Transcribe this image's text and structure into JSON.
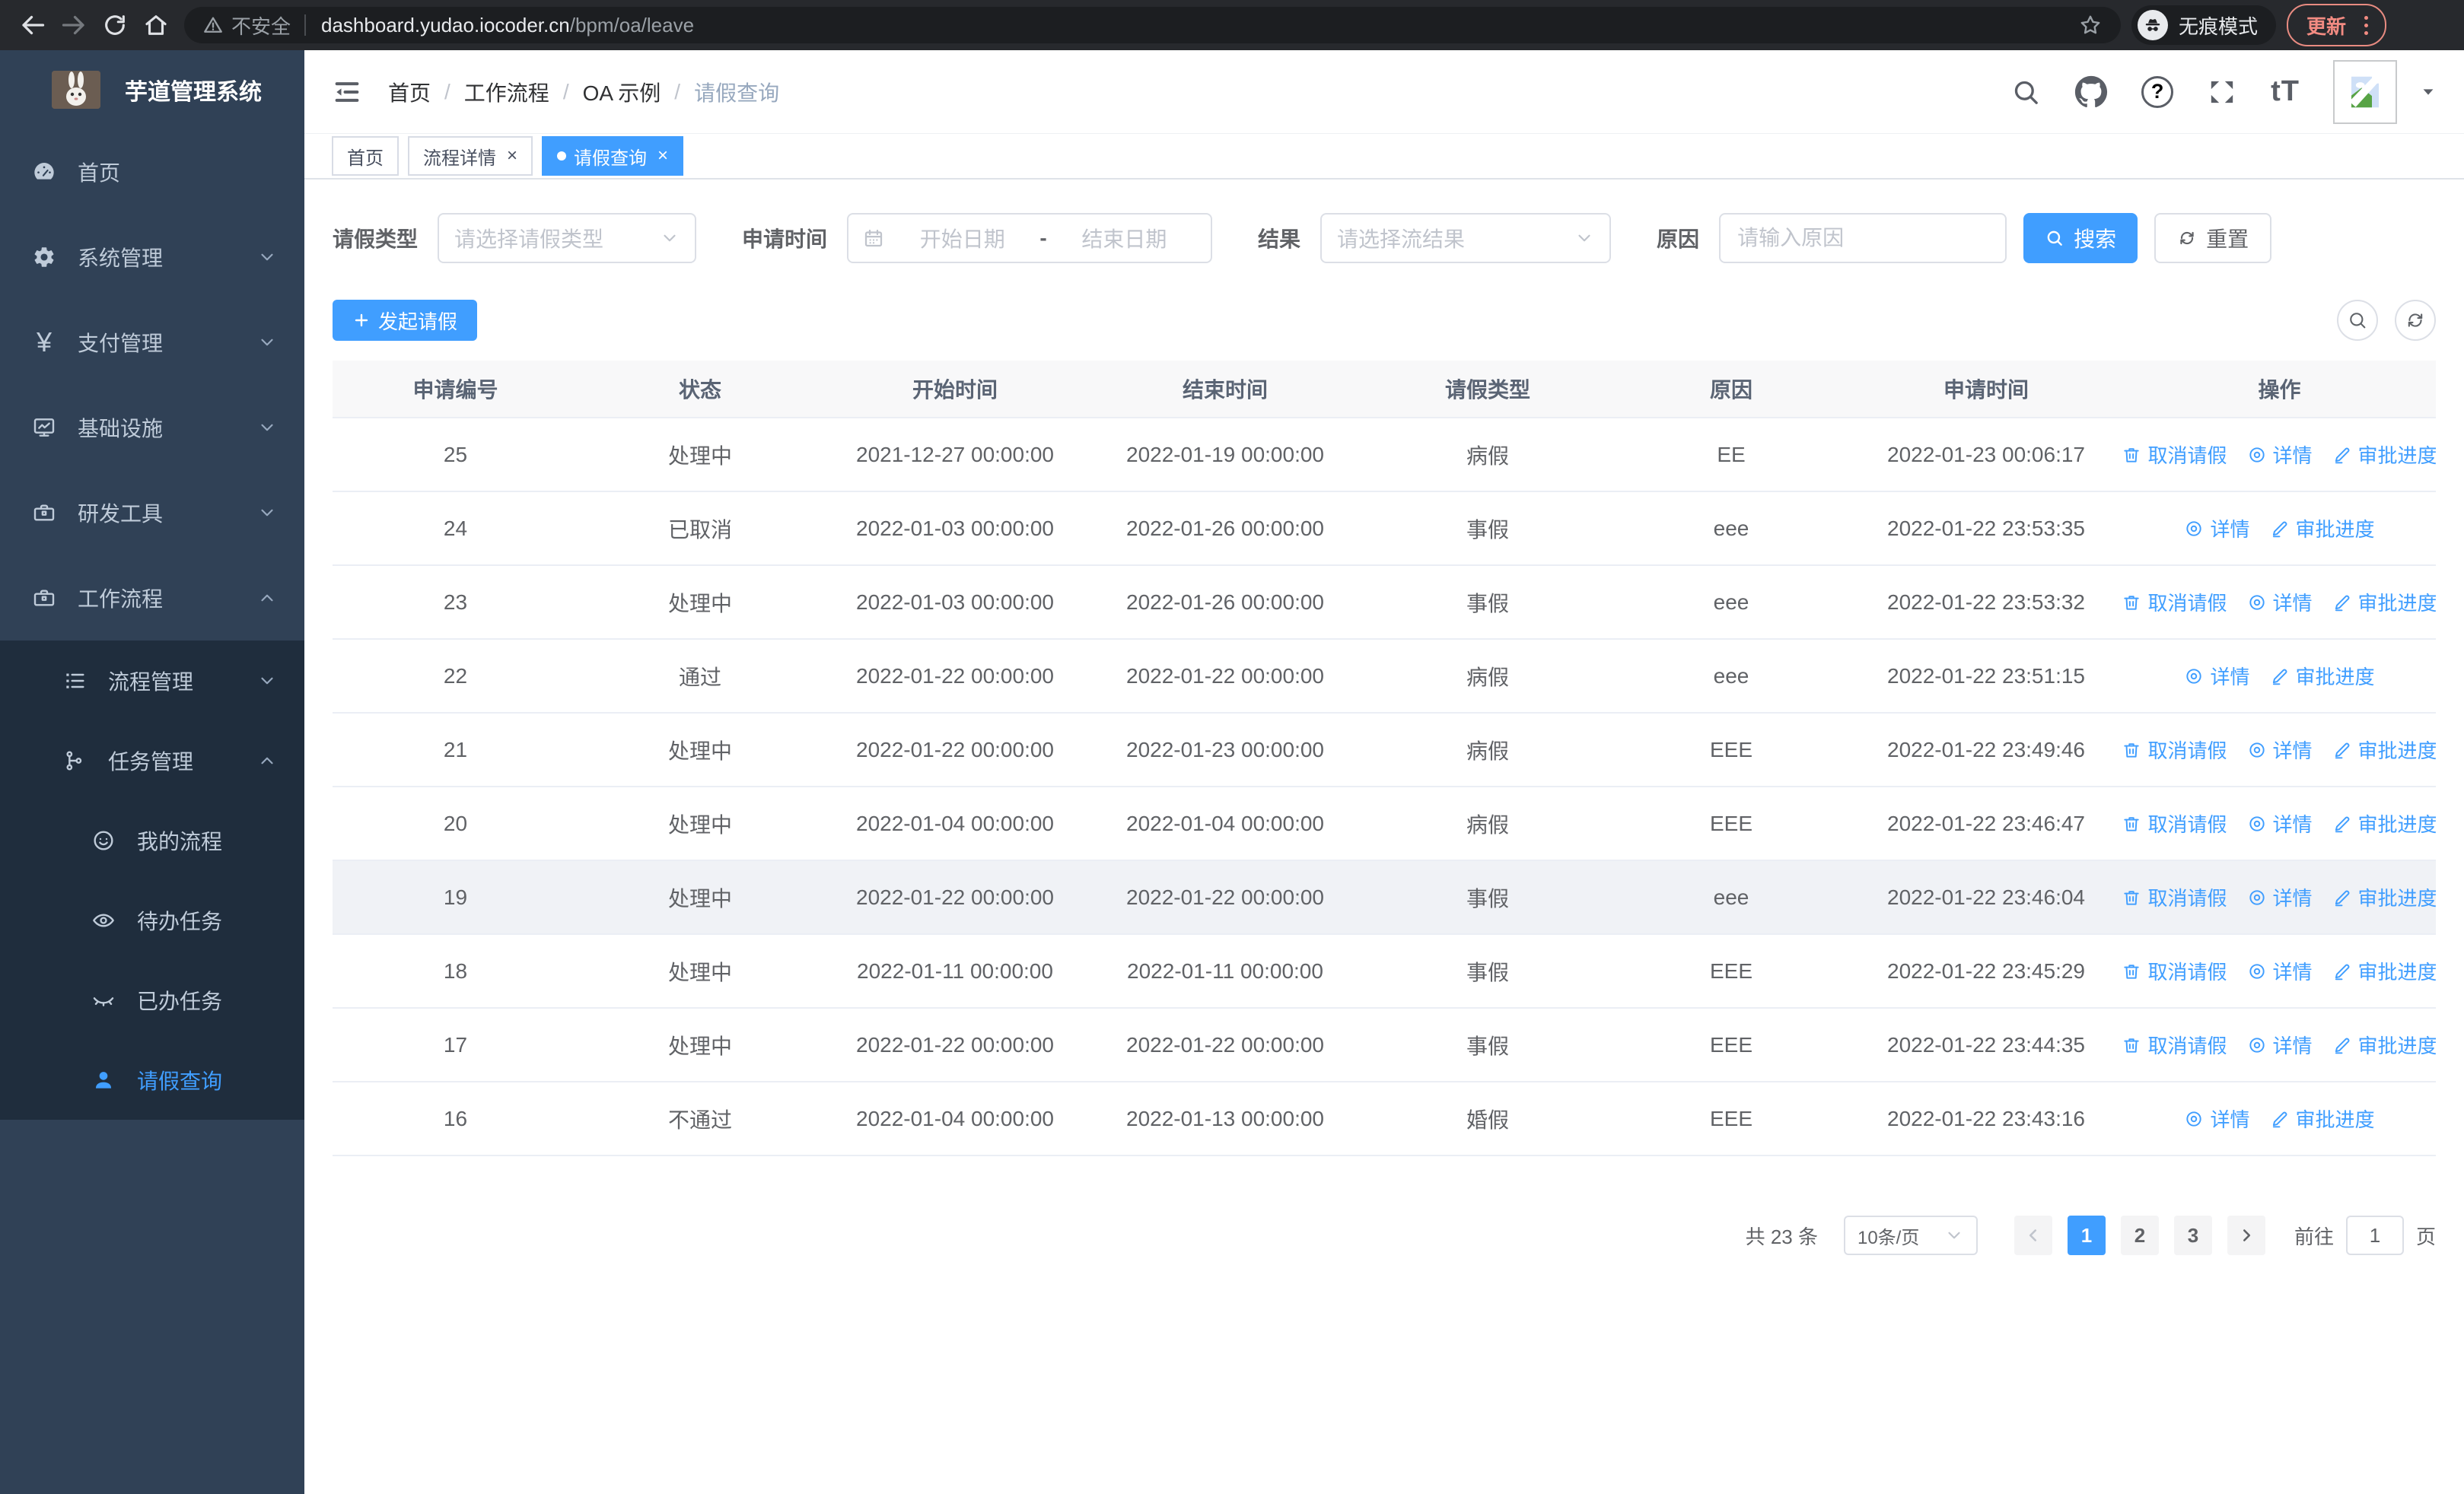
{
  "browser": {
    "security_label": "不安全",
    "url_domain": "dashboard.yudao.iocoder.cn",
    "url_path": "/bpm/oa/leave",
    "incognito_label": "无痕模式",
    "update_label": "更新"
  },
  "sidebar": {
    "title": "芋道管理系统",
    "menu": [
      {
        "label": "首页",
        "icon": "dashboard-icon",
        "level": 0
      },
      {
        "label": "系统管理",
        "icon": "gear-icon",
        "level": 0,
        "arrow": "down"
      },
      {
        "label": "支付管理",
        "icon": "yen-icon",
        "glyph": "¥",
        "level": 0,
        "arrow": "down"
      },
      {
        "label": "基础设施",
        "icon": "monitor-icon",
        "level": 0,
        "arrow": "down"
      },
      {
        "label": "研发工具",
        "icon": "toolbox-icon",
        "level": 0,
        "arrow": "down"
      },
      {
        "label": "工作流程",
        "icon": "briefcase-icon",
        "level": 0,
        "arrow": "up"
      },
      {
        "label": "流程管理",
        "icon": "list-tree-icon",
        "level": 1,
        "arrow": "down"
      },
      {
        "label": "任务管理",
        "icon": "node-tree-icon",
        "level": 1,
        "arrow": "up"
      },
      {
        "label": "我的流程",
        "icon": "face-icon",
        "level": 2
      },
      {
        "label": "待办任务",
        "icon": "eye-icon",
        "level": 2
      },
      {
        "label": "已办任务",
        "icon": "eye-closed-icon",
        "level": 2
      },
      {
        "label": "请假查询",
        "icon": "user-icon",
        "level": 2,
        "active": true
      }
    ]
  },
  "breadcrumb": {
    "separator": "/",
    "items": [
      "首页",
      "工作流程",
      "OA 示例",
      "请假查询"
    ]
  },
  "tabbar": {
    "close_glyph": "×",
    "tabs": [
      {
        "label": "首页"
      },
      {
        "label": "流程详情",
        "closable": true
      },
      {
        "label": "请假查询",
        "closable": true,
        "active": true
      }
    ]
  },
  "navbar": {
    "font_size_icon_text": "tT"
  },
  "filters": {
    "leave_type_label": "请假类型",
    "leave_type_placeholder": "请选择请假类型",
    "apply_time_label": "申请时间",
    "date_start_placeholder": "开始日期",
    "date_separator": "-",
    "date_end_placeholder": "结束日期",
    "result_label": "结果",
    "result_placeholder": "请选择流结果",
    "reason_label": "原因",
    "reason_placeholder": "请输入原因",
    "search_label": "搜索",
    "reset_label": "重置"
  },
  "toolbar": {
    "create_label": "发起请假"
  },
  "table": {
    "columns": [
      "申请编号",
      "状态",
      "开始时间",
      "结束时间",
      "请假类型",
      "原因",
      "申请时间",
      "操作"
    ],
    "action_labels": {
      "cancel": "取消请假",
      "detail": "详情",
      "progress": "审批进度"
    },
    "rows": [
      {
        "id": "25",
        "status": "处理中",
        "start": "2021-12-27 00:00:00",
        "end": "2022-01-19 00:00:00",
        "type": "病假",
        "reason": "EE",
        "apply_time": "2022-01-23 00:06:17",
        "cancel": true
      },
      {
        "id": "24",
        "status": "已取消",
        "start": "2022-01-03 00:00:00",
        "end": "2022-01-26 00:00:00",
        "type": "事假",
        "reason": "eee",
        "apply_time": "2022-01-22 23:53:35",
        "cancel": false
      },
      {
        "id": "23",
        "status": "处理中",
        "start": "2022-01-03 00:00:00",
        "end": "2022-01-26 00:00:00",
        "type": "事假",
        "reason": "eee",
        "apply_time": "2022-01-22 23:53:32",
        "cancel": true
      },
      {
        "id": "22",
        "status": "通过",
        "start": "2022-01-22 00:00:00",
        "end": "2022-01-22 00:00:00",
        "type": "病假",
        "reason": "eee",
        "apply_time": "2022-01-22 23:51:15",
        "cancel": false
      },
      {
        "id": "21",
        "status": "处理中",
        "start": "2022-01-22 00:00:00",
        "end": "2022-01-23 00:00:00",
        "type": "病假",
        "reason": "EEE",
        "apply_time": "2022-01-22 23:49:46",
        "cancel": true
      },
      {
        "id": "20",
        "status": "处理中",
        "start": "2022-01-04 00:00:00",
        "end": "2022-01-04 00:00:00",
        "type": "病假",
        "reason": "EEE",
        "apply_time": "2022-01-22 23:46:47",
        "cancel": true
      },
      {
        "id": "19",
        "status": "处理中",
        "start": "2022-01-22 00:00:00",
        "end": "2022-01-22 00:00:00",
        "type": "事假",
        "reason": "eee",
        "apply_time": "2022-01-22 23:46:04",
        "cancel": true,
        "highlight": true
      },
      {
        "id": "18",
        "status": "处理中",
        "start": "2022-01-11 00:00:00",
        "end": "2022-01-11 00:00:00",
        "type": "事假",
        "reason": "EEE",
        "apply_time": "2022-01-22 23:45:29",
        "cancel": true
      },
      {
        "id": "17",
        "status": "处理中",
        "start": "2022-01-22 00:00:00",
        "end": "2022-01-22 00:00:00",
        "type": "事假",
        "reason": "EEE",
        "apply_time": "2022-01-22 23:44:35",
        "cancel": true
      },
      {
        "id": "16",
        "status": "不通过",
        "start": "2022-01-04 00:00:00",
        "end": "2022-01-13 00:00:00",
        "type": "婚假",
        "reason": "EEE",
        "apply_time": "2022-01-22 23:43:16",
        "cancel": false
      }
    ]
  },
  "pagination": {
    "total_label": "共 23 条",
    "page_size": "10条/页",
    "pages": [
      "1",
      "2",
      "3"
    ],
    "active_page": "1",
    "goto_label": "前往",
    "goto_value": "1",
    "page_unit": "页"
  },
  "colors": {
    "primary": "#409eff",
    "sidebar_bg": "#304156",
    "submenu_bg": "#1f2d3d",
    "table_header_bg": "#f8f8f9",
    "update_accent": "#f28b82"
  }
}
